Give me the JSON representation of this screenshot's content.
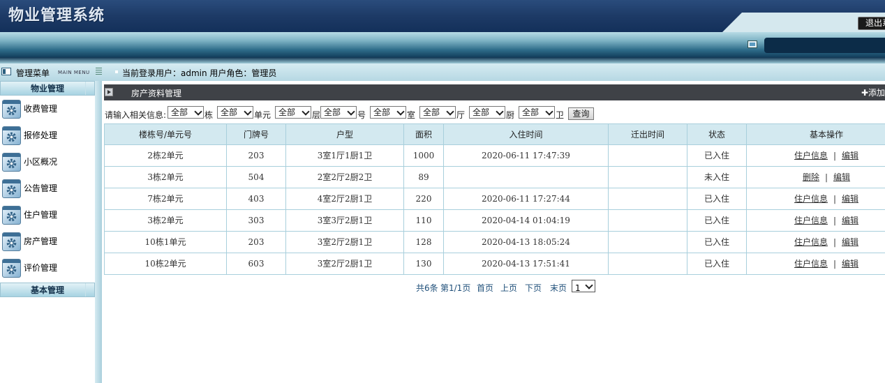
{
  "header": {
    "title": "物业管理系统",
    "logout_label": "退出系统"
  },
  "menu": {
    "title": "管理菜单",
    "title_en": "MAIN MENU"
  },
  "login_info": "当前登录用户：admin 用户角色：管理员",
  "sidebar": {
    "groups": [
      {
        "title": "物业管理"
      },
      {
        "title": "基本管理"
      }
    ],
    "items": [
      {
        "label": "收费管理"
      },
      {
        "label": "报修处理"
      },
      {
        "label": "小区概况"
      },
      {
        "label": "公告管理"
      },
      {
        "label": "住户管理"
      },
      {
        "label": "房产管理"
      },
      {
        "label": "评价管理"
      }
    ]
  },
  "panel": {
    "title": "房产资料管理",
    "add_label": "✚添加"
  },
  "filter": {
    "prompt": "请输入相关信息:",
    "selects": [
      {
        "value": "全部",
        "suffix": "栋"
      },
      {
        "value": "全部",
        "suffix": "单元"
      },
      {
        "value": "全部",
        "suffix": "层"
      },
      {
        "value": "全部",
        "suffix": "号"
      },
      {
        "value": "全部",
        "suffix": "室"
      },
      {
        "value": "全部",
        "suffix": "厅"
      },
      {
        "value": "全部",
        "suffix": "厨"
      },
      {
        "value": "全部",
        "suffix": "卫"
      }
    ],
    "query_label": "查询"
  },
  "table": {
    "headers": [
      "楼栋号/单元号",
      "门牌号",
      "户型",
      "面积",
      "入住时间",
      "迁出时间",
      "状态",
      "基本操作"
    ],
    "rows": [
      {
        "building": "2栋2单元",
        "door": "203",
        "layout": "3室1厅1厨1卫",
        "area": "1000",
        "checkin": "2020-06-11 17:47:39",
        "checkout": "",
        "status": "已入住",
        "action1": "住户信息",
        "action2": "编辑"
      },
      {
        "building": "3栋2单元",
        "door": "504",
        "layout": "2室2厅2厨2卫",
        "area": "89",
        "checkin": "",
        "checkout": "",
        "status": "未入住",
        "action1": "删除",
        "action2": "编辑"
      },
      {
        "building": "7栋2单元",
        "door": "403",
        "layout": "4室2厅2厨1卫",
        "area": "220",
        "checkin": "2020-06-11 17:27:44",
        "checkout": "",
        "status": "已入住",
        "action1": "住户信息",
        "action2": "编辑"
      },
      {
        "building": "3栋2单元",
        "door": "303",
        "layout": "3室3厅2厨1卫",
        "area": "110",
        "checkin": "2020-04-14 01:04:19",
        "checkout": "",
        "status": "已入住",
        "action1": "住户信息",
        "action2": "编辑"
      },
      {
        "building": "10栋1单元",
        "door": "203",
        "layout": "3室2厅2厨1卫",
        "area": "128",
        "checkin": "2020-04-13 18:05:24",
        "checkout": "",
        "status": "已入住",
        "action1": "住户信息",
        "action2": "编辑"
      },
      {
        "building": "10栋2单元",
        "door": "603",
        "layout": "3室2厅2厨1卫",
        "area": "130",
        "checkin": "2020-04-13 17:51:41",
        "checkout": "",
        "status": "已入住",
        "action1": "住户信息",
        "action2": "编辑"
      }
    ],
    "separator": "|"
  },
  "pager": {
    "total": "共6条",
    "page_info": "第1/1页",
    "first": "首页",
    "prev": "上页",
    "next": "下页",
    "last": "末页",
    "current_page": "1"
  }
}
